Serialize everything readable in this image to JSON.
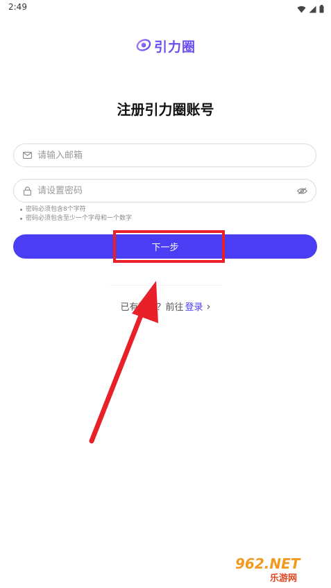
{
  "status_bar": {
    "time": "2:49"
  },
  "logo": {
    "text": "引力圈"
  },
  "page": {
    "title": "注册引力圈账号"
  },
  "form": {
    "email_placeholder": "请输入邮箱",
    "password_placeholder": "请设置密码",
    "hints": [
      "密码必须包含8个字符",
      "密码必须包含至少一个字母和一个数字"
    ],
    "next_label": "下一步"
  },
  "login": {
    "prefix": "已有账号？前往",
    "link": "登录",
    "chevron": "›"
  },
  "watermark": {
    "top": "962.NET",
    "bottom": "乐游网"
  },
  "colors": {
    "brand": "#4a3df3",
    "logo": "#6a4cf0",
    "annotation": "#e8202a"
  }
}
